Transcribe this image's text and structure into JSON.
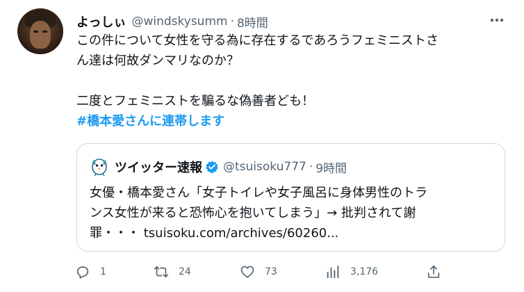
{
  "tweet": {
    "author": {
      "name": "よっしぃ",
      "handle": "@windskysumm",
      "separator": "·",
      "time": "8時間"
    },
    "body_lines": [
      "この件について女性を守る為に存在するであろうフェミニストさ",
      "ん達は何故ダンマリなのか？",
      "",
      "二度とフェミニストを騙るな偽善者ども！"
    ],
    "hashtag": "#橋本愛さんに連帯します",
    "more_icon": "more-horizontal-icon"
  },
  "quote": {
    "author": {
      "name": "ツイッター速報",
      "verified": true,
      "handle": "@tsuisoku777",
      "separator": "·",
      "time": "9時間"
    },
    "text_lines": [
      "女優・橋本愛さん「女子トイレや女子風呂に身体男性のトラ",
      "ンス女性が来ると恐怖心を抱いてしまう」→ 批判されて謝",
      "罪・・・ tsuisoku.com/archives/60260..."
    ]
  },
  "actions": {
    "reply_count": "1",
    "retweet_count": "24",
    "like_count": "73",
    "views_count": "3,176"
  },
  "colors": {
    "text": "#0f1419",
    "secondary": "#536471",
    "link": "#1d9bf0",
    "border": "#cfd9de",
    "verified": "#1d9bf0"
  }
}
